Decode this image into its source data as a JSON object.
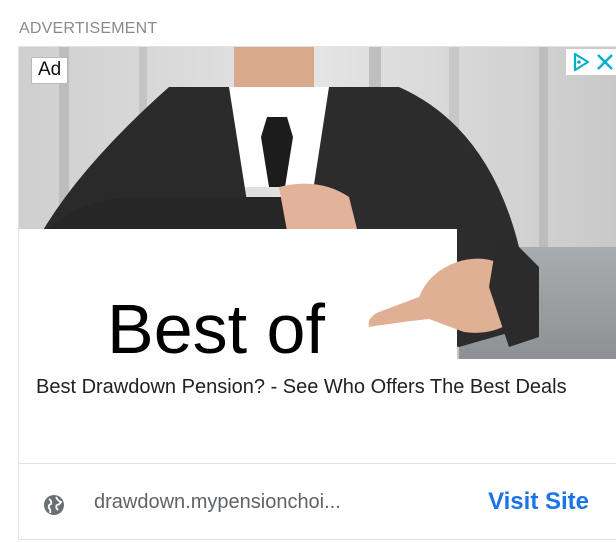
{
  "section_label": "ADVERTISEMENT",
  "ad": {
    "badge": "Ad",
    "image_text": "Best of",
    "headline": "Best Drawdown Pension? - See Who Offers The Best Deals",
    "domain": "drawdown.mypensionchoi...",
    "cta": "Visit Site"
  },
  "icons": {
    "adchoices": "adchoices-icon",
    "close": "close-icon",
    "globe": "globe-icon"
  },
  "colors": {
    "cta": "#1a73e8",
    "adchoices": "#00aecd",
    "label": "#8a8a8a"
  }
}
